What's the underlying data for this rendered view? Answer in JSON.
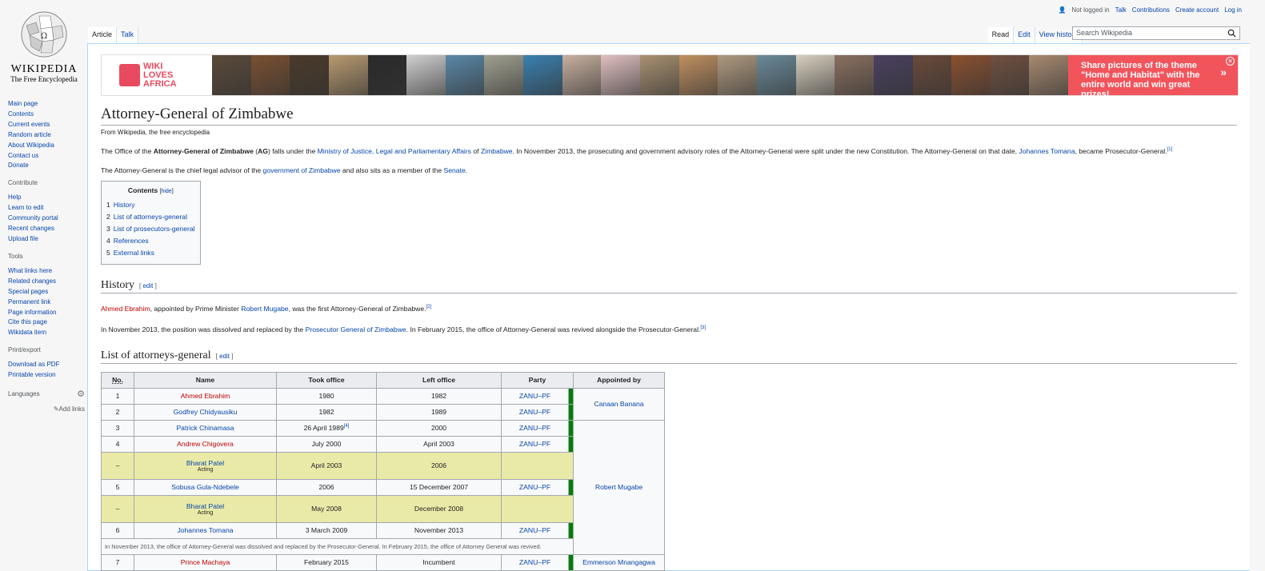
{
  "logo": {
    "wordmark": "WIKIPEDIA",
    "tagline": "The Free Encyclopedia"
  },
  "sidebar": {
    "nav": [
      "Main page",
      "Contents",
      "Current events",
      "Random article",
      "About Wikipedia",
      "Contact us",
      "Donate"
    ],
    "contribute_heading": "Contribute",
    "contribute": [
      "Help",
      "Learn to edit",
      "Community portal",
      "Recent changes",
      "Upload file"
    ],
    "tools_heading": "Tools",
    "tools": [
      "What links here",
      "Related changes",
      "Special pages",
      "Permanent link",
      "Page information",
      "Cite this page",
      "Wikidata item"
    ],
    "print_heading": "Print/export",
    "print": [
      "Download as PDF",
      "Printable version"
    ],
    "languages_heading": "Languages",
    "add_links": "Add links"
  },
  "personal": {
    "not_logged_in": "Not logged in",
    "talk": "Talk",
    "contributions": "Contributions",
    "create_account": "Create account",
    "log_in": "Log in"
  },
  "tabs": {
    "article": "Article",
    "talk": "Talk",
    "read": "Read",
    "edit": "Edit",
    "view_history": "View history"
  },
  "search": {
    "placeholder": "Search Wikipedia"
  },
  "banner": {
    "logo_text_1": "WIKI",
    "logo_text_2": "LOVES",
    "logo_text_3": "AFRICA",
    "cta": "Share pictures of the theme \"Home and Habitat\" with the entire world and win great prizes!",
    "photo_colors": [
      "#5a4a3a",
      "#7a5030",
      "#4a3a2a",
      "#b89a70",
      "#2a2a2a",
      "#d0d0d0",
      "#5a88a8",
      "#a0a090",
      "#3a80b0",
      "#c8b0a0",
      "#e0c0c0",
      "#a89070",
      "#c09060",
      "#b09a80",
      "#6a8a9a",
      "#d8d0c0",
      "#8a7060",
      "#4a4060",
      "#6a4a3a",
      "#8a5030",
      "#705040",
      "#a88a70"
    ],
    "colors": {
      "cta_bg": "#f2545b",
      "accent": "#e84a5f"
    }
  },
  "article": {
    "title": "Attorney-General of Zimbabwe",
    "site_sub": "From Wikipedia, the free encyclopedia",
    "p1": {
      "a": "The Office of the ",
      "b": "Attorney-General of Zimbabwe",
      "c": " (",
      "d": "AG",
      "e": ") falls under the ",
      "link1": "Ministry of Justice, Legal and Parliamentary Affairs",
      "f": " of ",
      "link2": "Zimbabwe",
      "g": ". In November 2013, the prosecuting and government advisory roles of the Attorney-General were split under the new Constitution. The Attorney-General on that date, ",
      "link3": "Johannes Tomana",
      "h": ", became Prosecutor-General.",
      "ref": "[1]"
    },
    "p2": {
      "a": "The Attorney-General is the chief legal advisor of the ",
      "link1": "government of Zimbabwe",
      "b": " and also sits as a member of the ",
      "link2": "Senate",
      "c": "."
    },
    "toc": {
      "title": "Contents",
      "hide": "hide",
      "items": [
        {
          "num": "1",
          "label": "History"
        },
        {
          "num": "2",
          "label": "List of attorneys-general"
        },
        {
          "num": "3",
          "label": "List of prosecutors-general"
        },
        {
          "num": "4",
          "label": "References"
        },
        {
          "num": "5",
          "label": "External links"
        }
      ]
    },
    "history": {
      "heading": "History",
      "edit": "edit",
      "p1": {
        "link1": "Ahmed Ebrahim",
        "a": ", appointed by Prime Minister ",
        "link2": "Robert Mugabe",
        "b": ", was the first Attorney-General of Zimbabwe.",
        "ref": "[2]"
      },
      "p2": {
        "a": "In November 2013, the position was dissolved and replaced by the ",
        "link1": "Prosecutor General of Zimbabwe",
        "b": ". In February 2015, the office of Attorney-General was revived alongside the Prosecutor-General.",
        "ref": "[3]"
      }
    },
    "list": {
      "heading": "List of attorneys-general",
      "edit": "edit",
      "columns": [
        "No.",
        "Name",
        "Took office",
        "Left office",
        "Party",
        "Appointed by"
      ],
      "rows": [
        {
          "no": "1",
          "name": "Ahmed Ebrahim",
          "took": "1980",
          "left": "1982",
          "party": "ZANU–PF"
        },
        {
          "no": "2",
          "name": "Godfrey Chidyausiku",
          "took": "1982",
          "left": "1989",
          "party": "ZANU–PF"
        },
        {
          "no": "3",
          "name": "Patrick Chinamasa",
          "took": "26 April 1989",
          "took_ref": "[4]",
          "left": "2000",
          "party": "ZANU–PF"
        },
        {
          "no": "4",
          "name": "Andrew Chigovera",
          "took": "July 2000",
          "left": "April 2003",
          "party": "ZANU–PF"
        },
        {
          "no": "–",
          "name": "Bharat Patel",
          "sub": "Acting",
          "took": "April 2003",
          "left": "2006",
          "party": ""
        },
        {
          "no": "5",
          "name": "Sobusa Gula-Ndebele",
          "took": "2006",
          "left": "15 December 2007",
          "party": "ZANU–PF"
        },
        {
          "no": "–",
          "name": "Bharat Patel",
          "sub": "Acting",
          "took": "May 2008",
          "left": "December 2008",
          "party": ""
        },
        {
          "no": "6",
          "name": "Johannes Tomana",
          "took": "3 March 2009",
          "left": "November 2013",
          "party": "ZANU–PF"
        },
        {
          "no": "7",
          "name": "Prince Machaya",
          "took": "February 2015",
          "left": "Incumbent",
          "party": "ZANU–PF"
        }
      ],
      "appointers": [
        "Canaan Banana",
        "Robert Mugabe",
        "Emmerson Mnangagwa"
      ],
      "note": "In November 2013, the office of Attorney-General was dissolved and replaced by the Prosecutor-General. In February 2015, the office of Attorney General was revived.",
      "party_color": "#008000"
    }
  }
}
